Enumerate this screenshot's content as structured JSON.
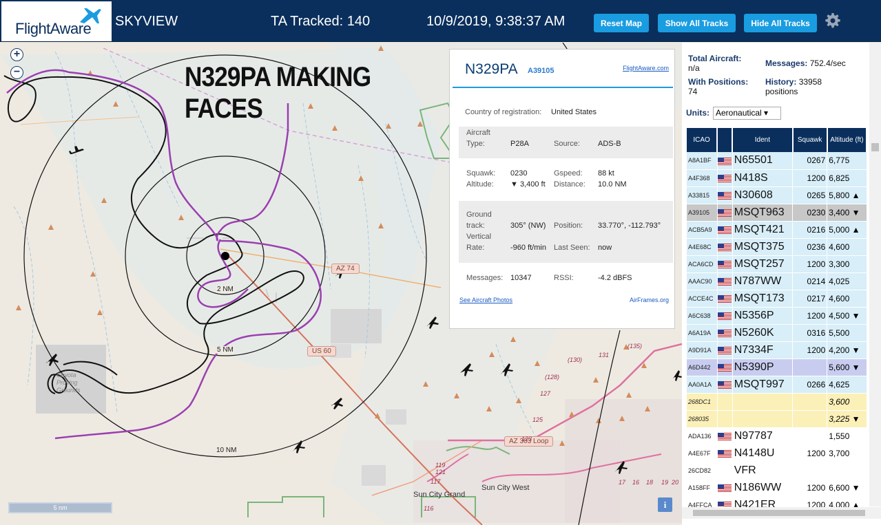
{
  "header": {
    "logo": "FlightAware",
    "app_name": "SKYVIEW",
    "ta_tracked": "TA Tracked: 140",
    "datetime": "10/9/2019, 9:38:37 AM",
    "reset_map": "Reset Map",
    "show_all_tracks": "Show All Tracks",
    "hide_all_tracks": "Hide All Tracks",
    "settings_icon": "gear-icon"
  },
  "map": {
    "zoom_in": "+",
    "zoom_out": "−",
    "annotation_line1": "N329PA MAKING",
    "annotation_line2": "FACES",
    "ring_labels": [
      "2 NM",
      "5 NM",
      "10 NM"
    ],
    "road_labels": [
      "US 60",
      "AZ 74",
      "AZ 303 Loop"
    ],
    "place_labels": [
      "Sun City Grand",
      "Sun City West",
      "Coyota Proving Grounds"
    ],
    "route_numbers": [
      "(135)",
      "131",
      "(130)",
      "(128)",
      "127",
      "125",
      "123",
      "121",
      "119",
      "117",
      "116",
      "17",
      "16",
      "18",
      "19",
      "20"
    ],
    "scale": "5 nm",
    "info": "i"
  },
  "popup": {
    "ident": "N329PA",
    "icao": "A39105",
    "link_flightaware": "FlightAware.com",
    "country_label": "Country of registration:",
    "country_value": "United States",
    "aircraft_type_label_1": "Aircraft",
    "aircraft_type_label_2": "Type:",
    "aircraft_type_value": "P28A",
    "source_label": "Source:",
    "source_value": "ADS-B",
    "squawk_label": "Squawk:",
    "squawk_value": "0230",
    "gspeed_label": "Gspeed:",
    "gspeed_value": "88 kt",
    "altitude_label": "Altitude:",
    "altitude_value": "▼ 3,400 ft",
    "distance_label": "Distance:",
    "distance_value": "10.0 NM",
    "ground_label_1": "Ground",
    "ground_label_2": "track:",
    "ground_value": "305° (NW)",
    "position_label": "Position:",
    "position_value": "33.770°, -112.793°",
    "vrate_label_1": "Vertical",
    "vrate_label_2": "Rate:",
    "vrate_value": "-960 ft/min",
    "lastseen_label": "Last Seen:",
    "lastseen_value": "now",
    "messages_label": "Messages:",
    "messages_value": "10347",
    "rssi_label": "RSSI:",
    "rssi_value": "-4.2 dBFS",
    "link_photos": "See Aircraft Photos",
    "link_airframes": "AirFrames.org"
  },
  "side": {
    "total_label": "Total Aircraft:",
    "total_value": "n/a",
    "messages_label": "Messages:",
    "messages_value": "752.4/sec",
    "withpos_label": "With Positions:",
    "withpos_value": "74",
    "history_label": "History:",
    "history_value": "33958",
    "history_suffix": "positions",
    "units_label": "Units:",
    "units_value": "Aeronautical ▾",
    "columns": [
      "ICAO",
      "",
      "Ident",
      "Squawk",
      "Altitude (ft)"
    ],
    "rows": [
      {
        "icao": "A8A1BF",
        "ident": "N65501",
        "squawk": "0267",
        "alt": "6,775",
        "flag": true,
        "style": "r"
      },
      {
        "icao": "A4F368",
        "ident": "N418S",
        "squawk": "1200",
        "alt": "6,825",
        "flag": true,
        "style": "r"
      },
      {
        "icao": "A33815",
        "ident": "N30608",
        "squawk": "0265",
        "alt": "5,800 ▲",
        "flag": true,
        "style": "r"
      },
      {
        "icao": "A39105",
        "ident": "MSQT963",
        "squawk": "0230",
        "alt": "3,400 ▼",
        "flag": true,
        "style": "sel"
      },
      {
        "icao": "ACB5A9",
        "ident": "MSQT421",
        "squawk": "0216",
        "alt": "5,000 ▲",
        "flag": true,
        "style": "r"
      },
      {
        "icao": "A4E68C",
        "ident": "MSQT375",
        "squawk": "0236",
        "alt": "4,600",
        "flag": true,
        "style": "r"
      },
      {
        "icao": "ACA6CD",
        "ident": "MSQT257",
        "squawk": "1200",
        "alt": "3,300",
        "flag": true,
        "style": "r"
      },
      {
        "icao": "AAAC90",
        "ident": "N787WW",
        "squawk": "0214",
        "alt": "4,025",
        "flag": true,
        "style": "r"
      },
      {
        "icao": "ACCE4C",
        "ident": "MSQT173",
        "squawk": "0217",
        "alt": "4,600",
        "flag": true,
        "style": "r"
      },
      {
        "icao": "A6C638",
        "ident": "N5356P",
        "squawk": "1200",
        "alt": "4,500 ▼",
        "flag": true,
        "style": "r"
      },
      {
        "icao": "A6A19A",
        "ident": "N5260K",
        "squawk": "0316",
        "alt": "5,500",
        "flag": true,
        "style": "r"
      },
      {
        "icao": "A9D91A",
        "ident": "N7334F",
        "squawk": "1200",
        "alt": "4,200 ▼",
        "flag": true,
        "style": "r"
      },
      {
        "icao": "A6D442",
        "ident": "N5390P",
        "squawk": "",
        "alt": "5,600 ▼",
        "flag": true,
        "style": "hl"
      },
      {
        "icao": "AA0A1A",
        "ident": "MSQT997",
        "squawk": "0266",
        "alt": "4,625",
        "flag": true,
        "style": "r"
      },
      {
        "icao": "268DC1",
        "ident": "",
        "squawk": "",
        "alt": "3,600",
        "flag": false,
        "style": "y"
      },
      {
        "icao": "268035",
        "ident": "",
        "squawk": "",
        "alt": "3,225 ▼",
        "flag": false,
        "style": "y"
      },
      {
        "icao": "ADA136",
        "ident": "N97787",
        "squawk": "",
        "alt": "1,550",
        "flag": true,
        "style": "w"
      },
      {
        "icao": "A4E67F",
        "ident": "N4148U",
        "squawk": "1200",
        "alt": "3,700",
        "flag": true,
        "style": "w"
      },
      {
        "icao": "26CD82",
        "ident": "VFR",
        "squawk": "",
        "alt": "",
        "flag": false,
        "style": "w"
      },
      {
        "icao": "A158FF",
        "ident": "N186WW",
        "squawk": "1200",
        "alt": "6,600 ▼",
        "flag": true,
        "style": "w"
      },
      {
        "icao": "A4FFCA",
        "ident": "N421ER",
        "squawk": "1200",
        "alt": "4,000 ▲",
        "flag": true,
        "style": "w"
      }
    ]
  },
  "colors": {
    "header_bg": "#0a2f5c",
    "button_bg": "#1a9ce0",
    "track_purple": "#9b3fb0",
    "map_bg": "#eeeae2"
  }
}
